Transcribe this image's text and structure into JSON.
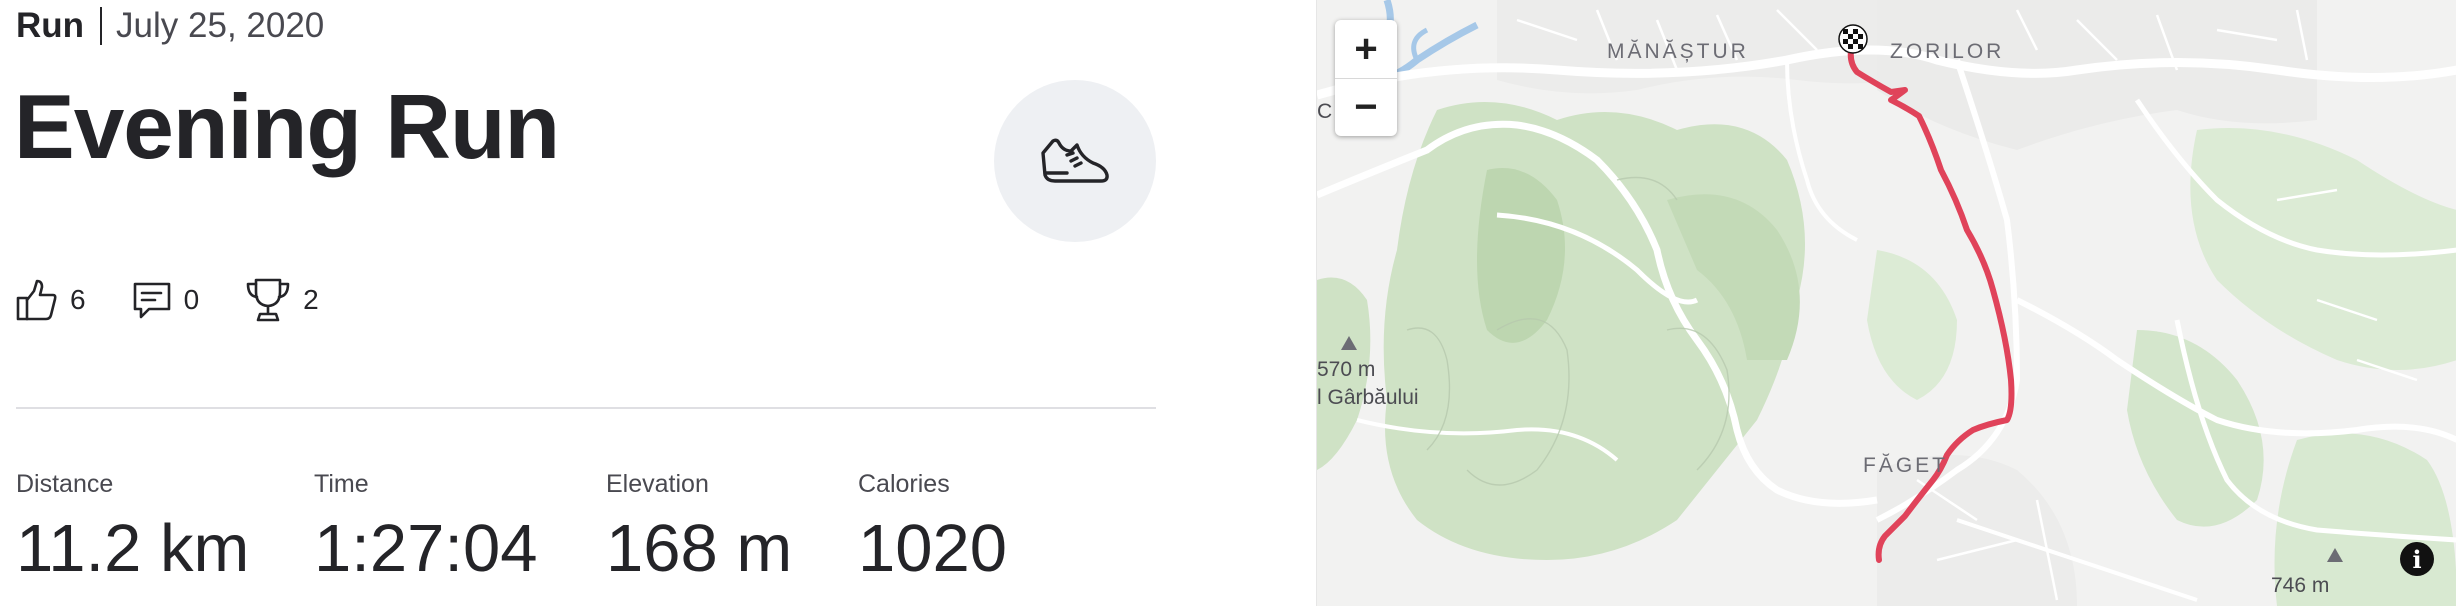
{
  "header": {
    "activity_type": "Run",
    "date": "July 25, 2020"
  },
  "activity": {
    "title": "Evening Run",
    "sport_icon": "running-shoe-icon"
  },
  "social": {
    "kudos_icon": "thumbs-up-icon",
    "kudos_count": "6",
    "comments_icon": "comment-icon",
    "comments_count": "0",
    "achievements_icon": "trophy-icon",
    "achievements_count": "2"
  },
  "stats": [
    {
      "label": "Distance",
      "value": "11.2 km"
    },
    {
      "label": "Time",
      "value": "1:27:04"
    },
    {
      "label": "Elevation",
      "value": "168 m"
    },
    {
      "label": "Calories",
      "value": "1020"
    }
  ],
  "map": {
    "zoom_in": "+",
    "zoom_out": "−",
    "info": "i",
    "route_color": "#e0435a",
    "finish_icon": "checkered-flag-icon",
    "labels": {
      "manastur": "MĂNĂȘTUR",
      "zorilor": "ZORILOR",
      "faget": "FĂGET",
      "peak_left_elev": "570 m",
      "peak_left_name": "l Gârbăului",
      "peak_right_elev": "746 m",
      "edge_fragment": "C"
    }
  }
}
